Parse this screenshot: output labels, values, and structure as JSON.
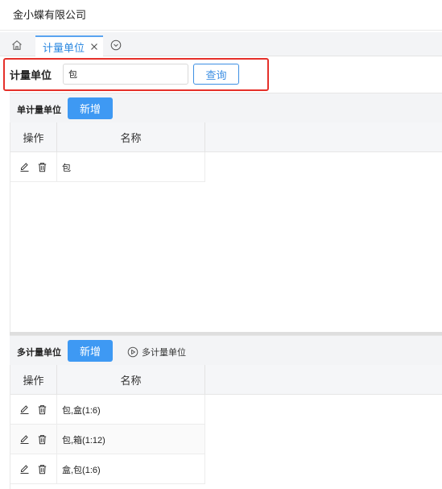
{
  "app": {
    "company_name": "金小蝶有限公司"
  },
  "tabs": [
    {
      "label": "计量单位",
      "active": true
    }
  ],
  "search": {
    "label": "计量单位",
    "value": "包",
    "query_label": "查询"
  },
  "single_unit": {
    "title": "单计量单位",
    "add_label": "新增",
    "columns": {
      "op": "操作",
      "name": "名称"
    },
    "rows": [
      {
        "name": "包"
      }
    ]
  },
  "multi_unit": {
    "title": "多计量单位",
    "add_label": "新增",
    "link_label": "多计量单位",
    "columns": {
      "op": "操作",
      "name": "名称"
    },
    "rows": [
      {
        "name": "包,盒(1:6)"
      },
      {
        "name": "包,箱(1:12)"
      },
      {
        "name": "盒,包(1:6)"
      }
    ]
  },
  "colors": {
    "accent": "#3e99f3",
    "tab_active": "#2b88e0",
    "highlight_border": "#e5302a"
  },
  "icons": {
    "home": "home-icon",
    "close": "close-icon",
    "more": "chevron-down-circle-icon",
    "edit": "edit-icon",
    "delete": "trash-icon",
    "play": "play-circle-icon"
  }
}
